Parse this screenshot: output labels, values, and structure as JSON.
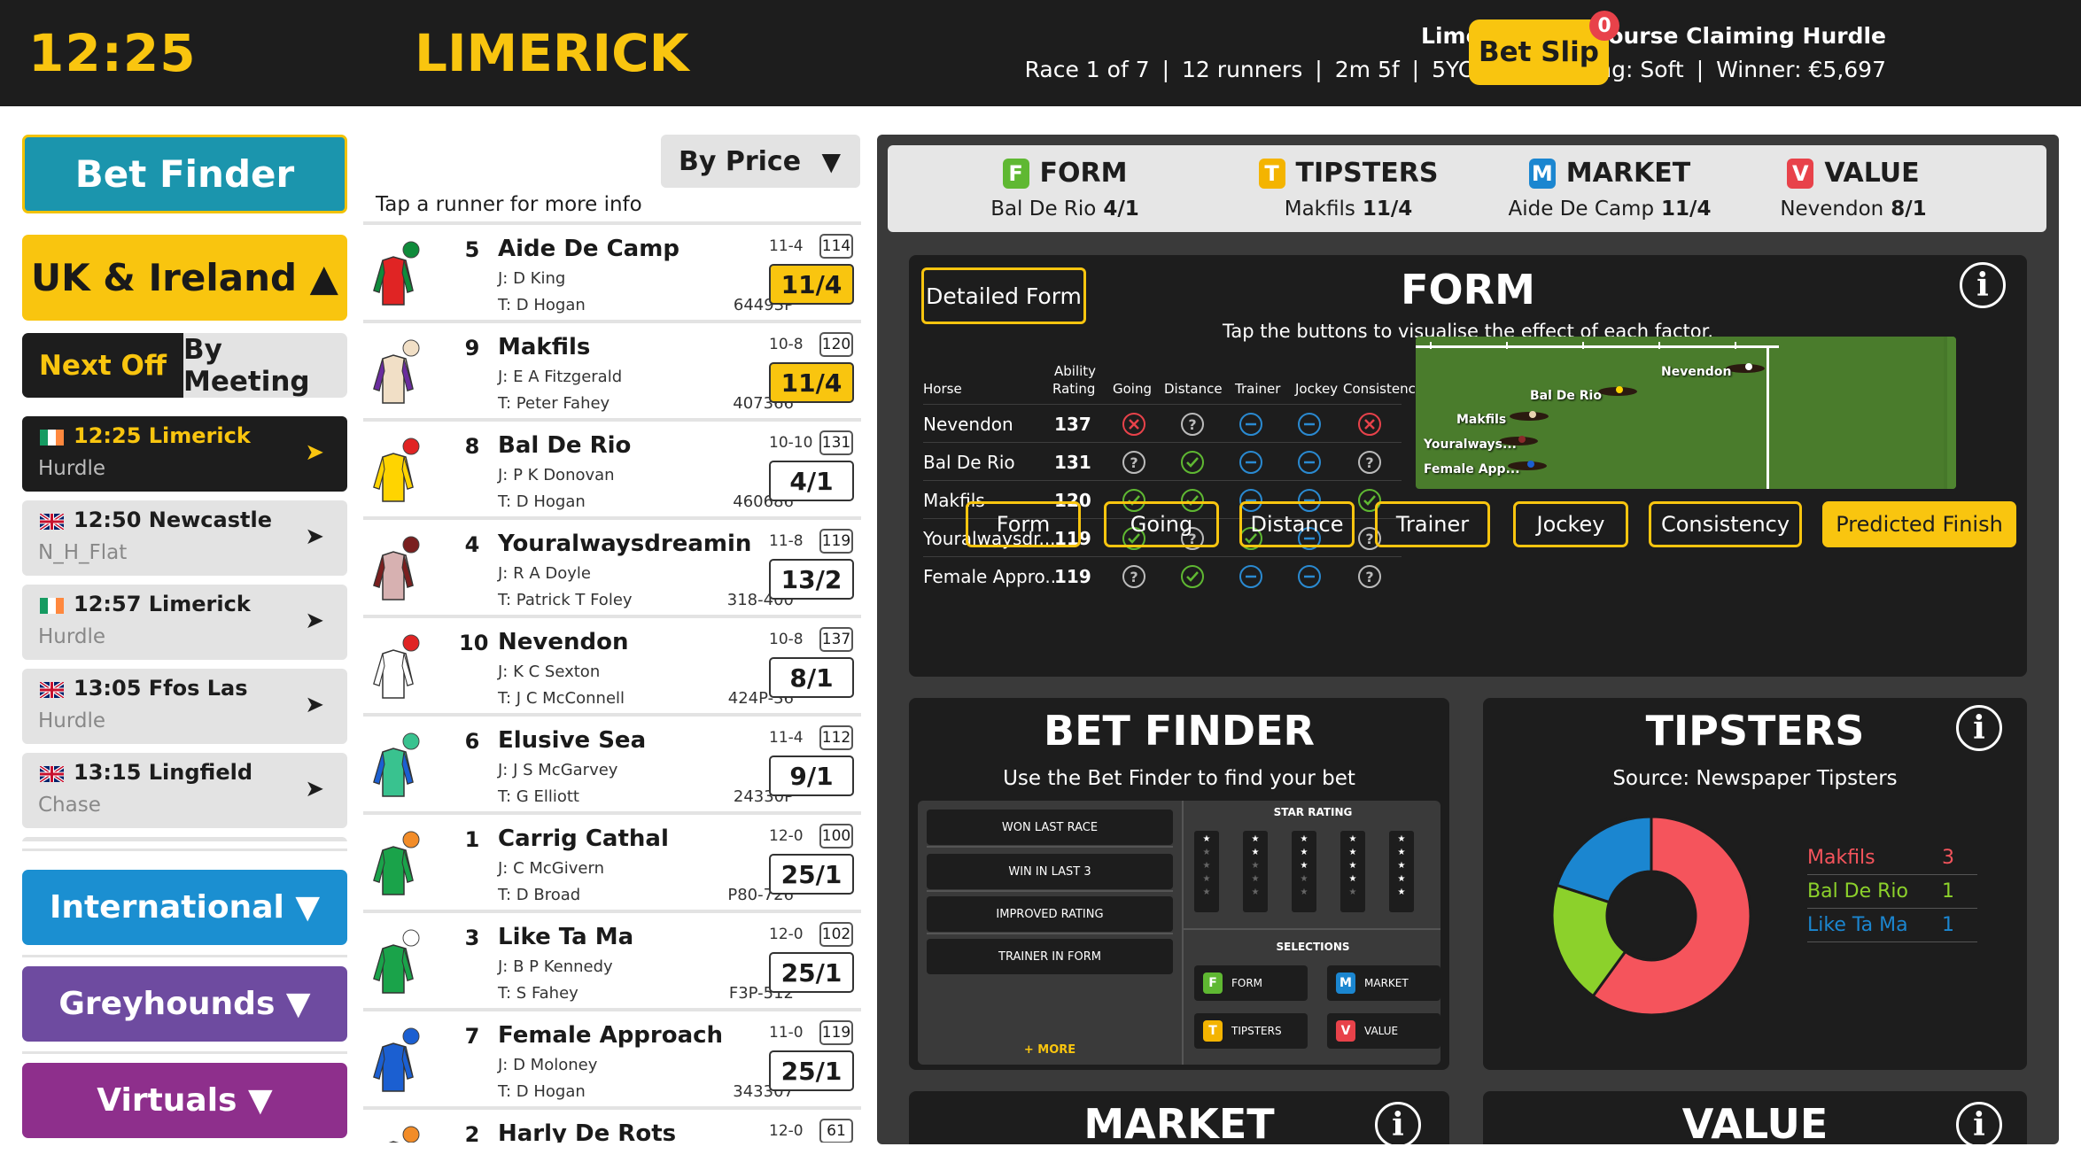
{
  "header": {
    "time": "12:25",
    "venue": "LIMERICK",
    "race_title": "Limerick Racecourse Claiming Hurdle",
    "meta": [
      "Race 1 of 7",
      "12 runners",
      "2m 5f",
      "5YO plus",
      "Going: Soft",
      "Winner: €5,697"
    ],
    "betslip_label": "Bet Slip",
    "betslip_count": "0"
  },
  "nav": {
    "bet_finder": "Bet Finder",
    "uk_ireland": "UK & Ireland ▲",
    "next_off": "Next Off",
    "by_meeting": "By Meeting",
    "races": [
      {
        "flag": "ireland-flag-icon",
        "time_venue": "12:25 Limerick",
        "type": "Hurdle",
        "active": true
      },
      {
        "flag": "uk-flag-icon",
        "time_venue": "12:50 Newcastle",
        "type": "N_H_Flat",
        "active": false
      },
      {
        "flag": "ireland-flag-icon",
        "time_venue": "12:57 Limerick",
        "type": "Hurdle",
        "active": false
      },
      {
        "flag": "uk-flag-icon",
        "time_venue": "13:05 Ffos Las",
        "type": "Hurdle",
        "active": false
      },
      {
        "flag": "uk-flag-icon",
        "time_venue": "13:15 Lingfield",
        "type": "Chase",
        "active": false
      }
    ],
    "arrow": "➤",
    "international": "International ▼",
    "greyhounds": "Greyhounds ▼",
    "virtuals": "Virtuals ▼"
  },
  "runners_panel": {
    "sort_label": "By Price",
    "sort_arrow": "▼",
    "tap_note": "Tap a runner for more info",
    "runners": [
      {
        "num": "5",
        "name": "Aide De Camp",
        "jockey": "J: D King",
        "trainer": "T: D Hogan",
        "form": "64493P",
        "age_wt": "11-4",
        "rating": "114",
        "price": "11/4",
        "fav": true,
        "silk": "red-green-silk-icon"
      },
      {
        "num": "9",
        "name": "Makfils",
        "jockey": "J: E A Fitzgerald",
        "trainer": "T: Peter Fahey",
        "form": "407366",
        "age_wt": "10-8",
        "rating": "120",
        "price": "11/4",
        "fav": true,
        "silk": "beige-purple-silk-icon"
      },
      {
        "num": "8",
        "name": "Bal De Rio",
        "jockey": "J: P K Donovan",
        "trainer": "T: D Hogan",
        "form": "460686",
        "age_wt": "10-10",
        "rating": "131",
        "price": "4/1",
        "fav": false,
        "silk": "yellow-red-star-silk-icon"
      },
      {
        "num": "4",
        "name": "Youralwaysdreamin",
        "jockey": "J: R A Doyle",
        "trainer": "T: Patrick T Foley",
        "form": "318-400",
        "age_wt": "11-8",
        "rating": "119",
        "price": "13/2",
        "fav": false,
        "silk": "maroon-diamond-silk-icon"
      },
      {
        "num": "10",
        "name": "Nevendon",
        "jockey": "J: K C Sexton",
        "trainer": "T: J C McConnell",
        "form": "424P-36",
        "age_wt": "10-8",
        "rating": "137",
        "price": "8/1",
        "fav": false,
        "silk": "white-black-square-silk-icon"
      },
      {
        "num": "6",
        "name": "Elusive Sea",
        "jockey": "J: J S McGarvey",
        "trainer": "T: G Elliott",
        "form": "24330P",
        "age_wt": "11-4",
        "rating": "112",
        "price": "9/1",
        "fav": false,
        "silk": "green-blue-check-silk-icon"
      },
      {
        "num": "1",
        "name": "Carrig Cathal",
        "jockey": "J: C McGivern",
        "trainer": "T: D Broad",
        "form": "P80-726",
        "age_wt": "12-0",
        "rating": "100",
        "price": "25/1",
        "fav": false,
        "silk": "green-orange-star-silk-icon"
      },
      {
        "num": "3",
        "name": "Like Ta Ma",
        "jockey": "J: B P Kennedy",
        "trainer": "T: S Fahey",
        "form": "F3P-512",
        "age_wt": "12-0",
        "rating": "102",
        "price": "25/1",
        "fav": false,
        "silk": "green-white-stars-silk-icon"
      },
      {
        "num": "7",
        "name": "Female Approach",
        "jockey": "J: D Moloney",
        "trainer": "T: D Hogan",
        "form": "343307",
        "age_wt": "11-0",
        "rating": "119",
        "price": "25/1",
        "fav": false,
        "silk": "blue-yellow-star-silk-icon"
      },
      {
        "num": "2",
        "name": "Harly De Rots",
        "jockey": "",
        "trainer": "",
        "form": "",
        "age_wt": "12-0",
        "rating": "61",
        "price": "",
        "fav": false,
        "silk": "orange-red-stripe-silk-icon"
      }
    ]
  },
  "summary": [
    {
      "letter": "F",
      "title": "FORM",
      "horse": "Bal De Rio",
      "price": "4/1",
      "color": "#5fb832"
    },
    {
      "letter": "T",
      "title": "TIPSTERS",
      "horse": "Makfils",
      "price": "11/4",
      "color": "#f4b400"
    },
    {
      "letter": "M",
      "title": "MARKET",
      "horse": "Aide De Camp",
      "price": "11/4",
      "color": "#1b86d0"
    },
    {
      "letter": "V",
      "title": "VALUE",
      "horse": "Nevendon",
      "price": "8/1",
      "color": "#e8424a"
    }
  ],
  "form_card": {
    "detailed_btn": "Detailed Form",
    "title": "FORM",
    "subtitle": "Tap the buttons to visualise the effect of each factor.",
    "info": "i",
    "headers": {
      "horse": "Horse",
      "ability1": "Ability",
      "ability2": "Rating",
      "going": "Going",
      "distance": "Distance",
      "trainer": "Trainer",
      "jockey": "Jockey",
      "consistency": "Consistency"
    },
    "rows": [
      {
        "horse": "Nevendon",
        "rating": "137",
        "icons": [
          "cross",
          "question",
          "neutral",
          "neutral",
          "cross"
        ]
      },
      {
        "horse": "Bal De Rio",
        "rating": "131",
        "icons": [
          "question",
          "tick",
          "neutral",
          "neutral",
          "question"
        ]
      },
      {
        "horse": "Makfils",
        "rating": "120",
        "icons": [
          "tick",
          "tick",
          "neutral",
          "neutral",
          "tick"
        ]
      },
      {
        "horse": "Youralwaysdr...",
        "rating": "119",
        "icons": [
          "tick",
          "question",
          "tick",
          "neutral",
          "question"
        ]
      },
      {
        "horse": "Female Appro...",
        "rating": "119",
        "icons": [
          "question",
          "tick",
          "neutral",
          "neutral",
          "question"
        ]
      }
    ],
    "track_labels": [
      "Nevendon",
      "Bal De Rio",
      "Makfils",
      "Youralways...",
      "Female App..."
    ],
    "factor_buttons": [
      "Form",
      "Going",
      "Distance",
      "Trainer",
      "Jockey",
      "Consistency",
      "Predicted Finish"
    ],
    "active_factor": "Predicted Finish"
  },
  "bet_finder_card": {
    "title": "BET FINDER",
    "subtitle": "Use the Bet Finder to find your bet",
    "left_options": [
      "WON LAST RACE",
      "WIN IN LAST 3",
      "IMPROVED RATING",
      "TRAINER IN FORM"
    ],
    "more": "+ MORE",
    "star_title": "STAR RATING",
    "star_levels": [
      1,
      2,
      3,
      4,
      5
    ],
    "star_glyph": "★",
    "sel_title": "SELECTIONS",
    "selections": [
      {
        "letter": "F",
        "label": "FORM",
        "color": "#5fb832"
      },
      {
        "letter": "M",
        "label": "MARKET",
        "color": "#1b86d0"
      },
      {
        "letter": "T",
        "label": "TIPSTERS",
        "color": "#f4b400"
      },
      {
        "letter": "V",
        "label": "VALUE",
        "color": "#e8424a"
      }
    ]
  },
  "tipsters_card": {
    "title": "TIPSTERS",
    "subtitle": "Source: Newspaper Tipsters",
    "info": "i",
    "tips": [
      {
        "name": "Makfils",
        "count": 3,
        "color": "#f5545c"
      },
      {
        "name": "Bal De Rio",
        "count": 1,
        "color": "#8cd12b"
      },
      {
        "name": "Like Ta Ma",
        "count": 1,
        "color": "#1b86d0"
      }
    ]
  },
  "market_card": {
    "title": "MARKET",
    "info": "i"
  },
  "value_card": {
    "title": "VALUE",
    "info": "i"
  }
}
